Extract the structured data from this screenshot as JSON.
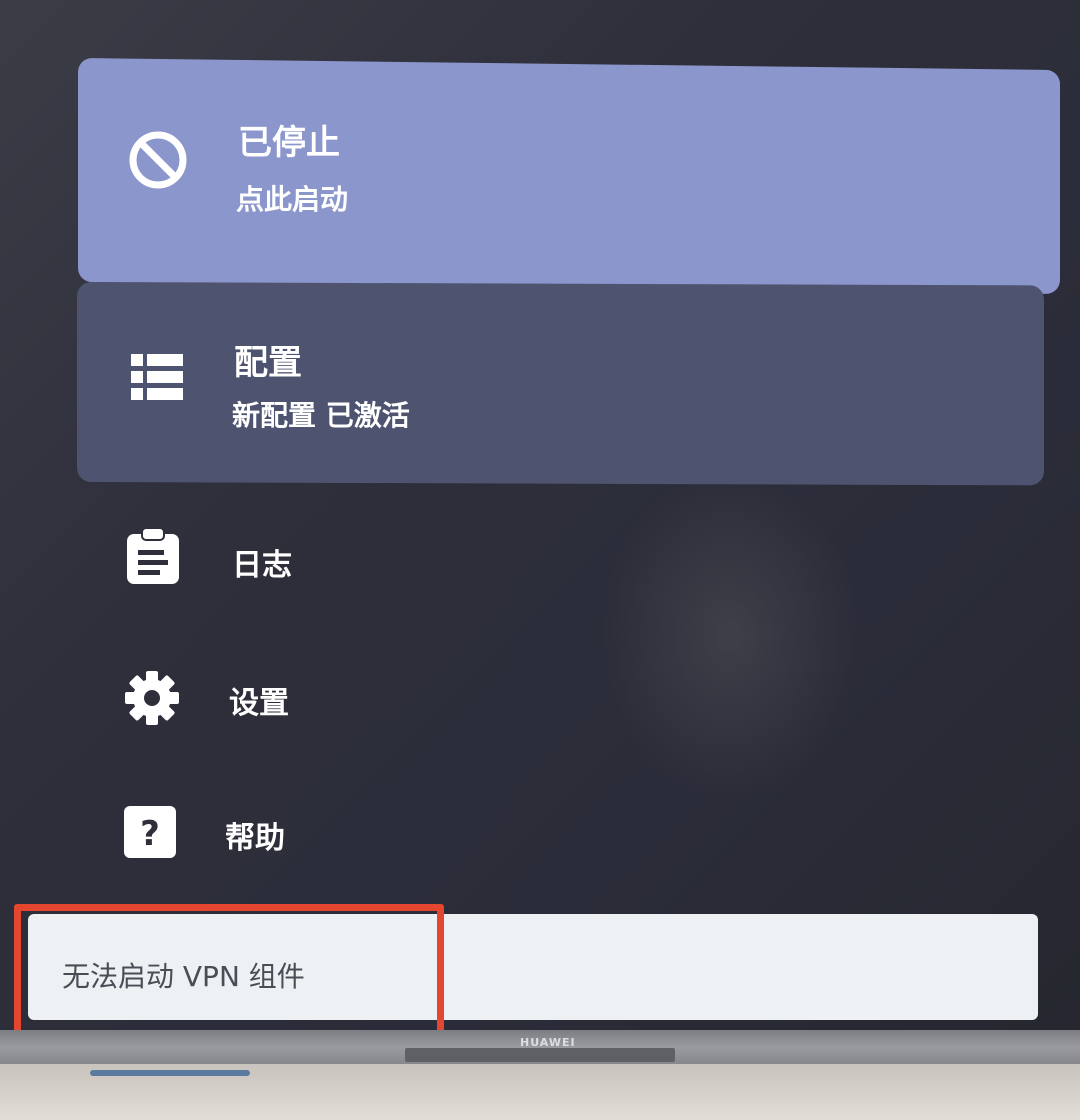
{
  "status_card": {
    "title": "已停止",
    "subtitle": "点此启动",
    "icon": "stop-icon",
    "color": "#8b96cc"
  },
  "config_card": {
    "title": "配置",
    "subtitle": "新配置 已激活",
    "icon": "list-icon",
    "color": "#4e5470"
  },
  "menu": [
    {
      "label": "日志",
      "icon": "clipboard-icon"
    },
    {
      "label": "设置",
      "icon": "gear-icon"
    },
    {
      "label": "帮助",
      "icon": "help-icon"
    }
  ],
  "toast": {
    "message": "无法启动 VPN 组件",
    "highlight_color": "#e5462f"
  },
  "device": {
    "brand": "HUAWEI"
  }
}
